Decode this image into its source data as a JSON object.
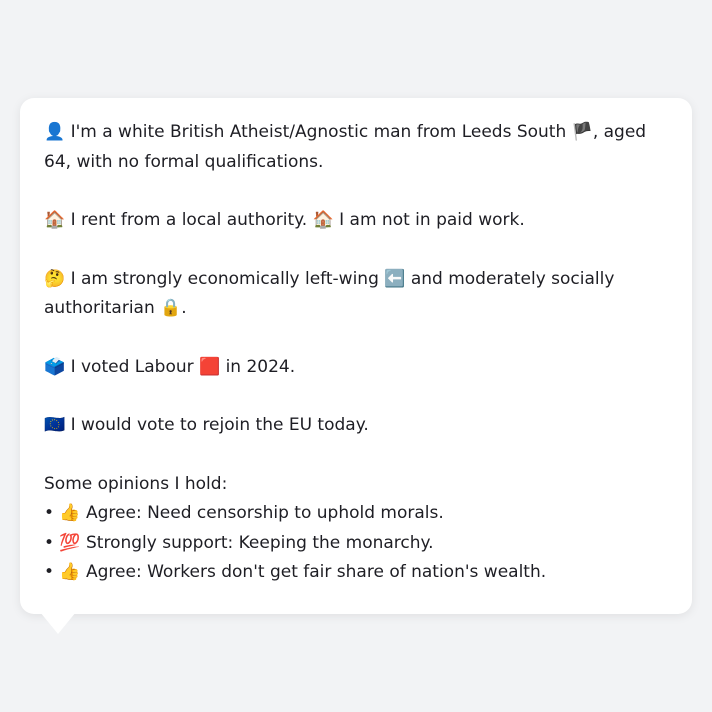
{
  "profile": {
    "paragraphs": [
      {
        "icon": "person-icon",
        "emoji": "👤",
        "text": " I'm a white British Atheist/Agnostic man from Leeds South ",
        "flag": "🏴",
        "tail": ", aged 64, with no formal qualifications."
      },
      {
        "text": "🏠 I rent from a local authority. 🏠 I am not in paid work."
      },
      {
        "text": "🤔 I am strongly economically left-wing ⬅️ and moderately socially authoritarian 🔒."
      },
      {
        "text": "🗳️ I voted Labour 🟥 in 2024."
      },
      {
        "text": "🇪🇺 I would vote to rejoin the EU today."
      }
    ],
    "opinions_header": "Some opinions I hold:",
    "opinions": [
      "• 👍 Agree: Need censorship to uphold morals.",
      "• 💯 Strongly support: Keeping the monarchy.",
      "• 👍 Agree: Workers don't get fair share of nation's wealth."
    ]
  }
}
